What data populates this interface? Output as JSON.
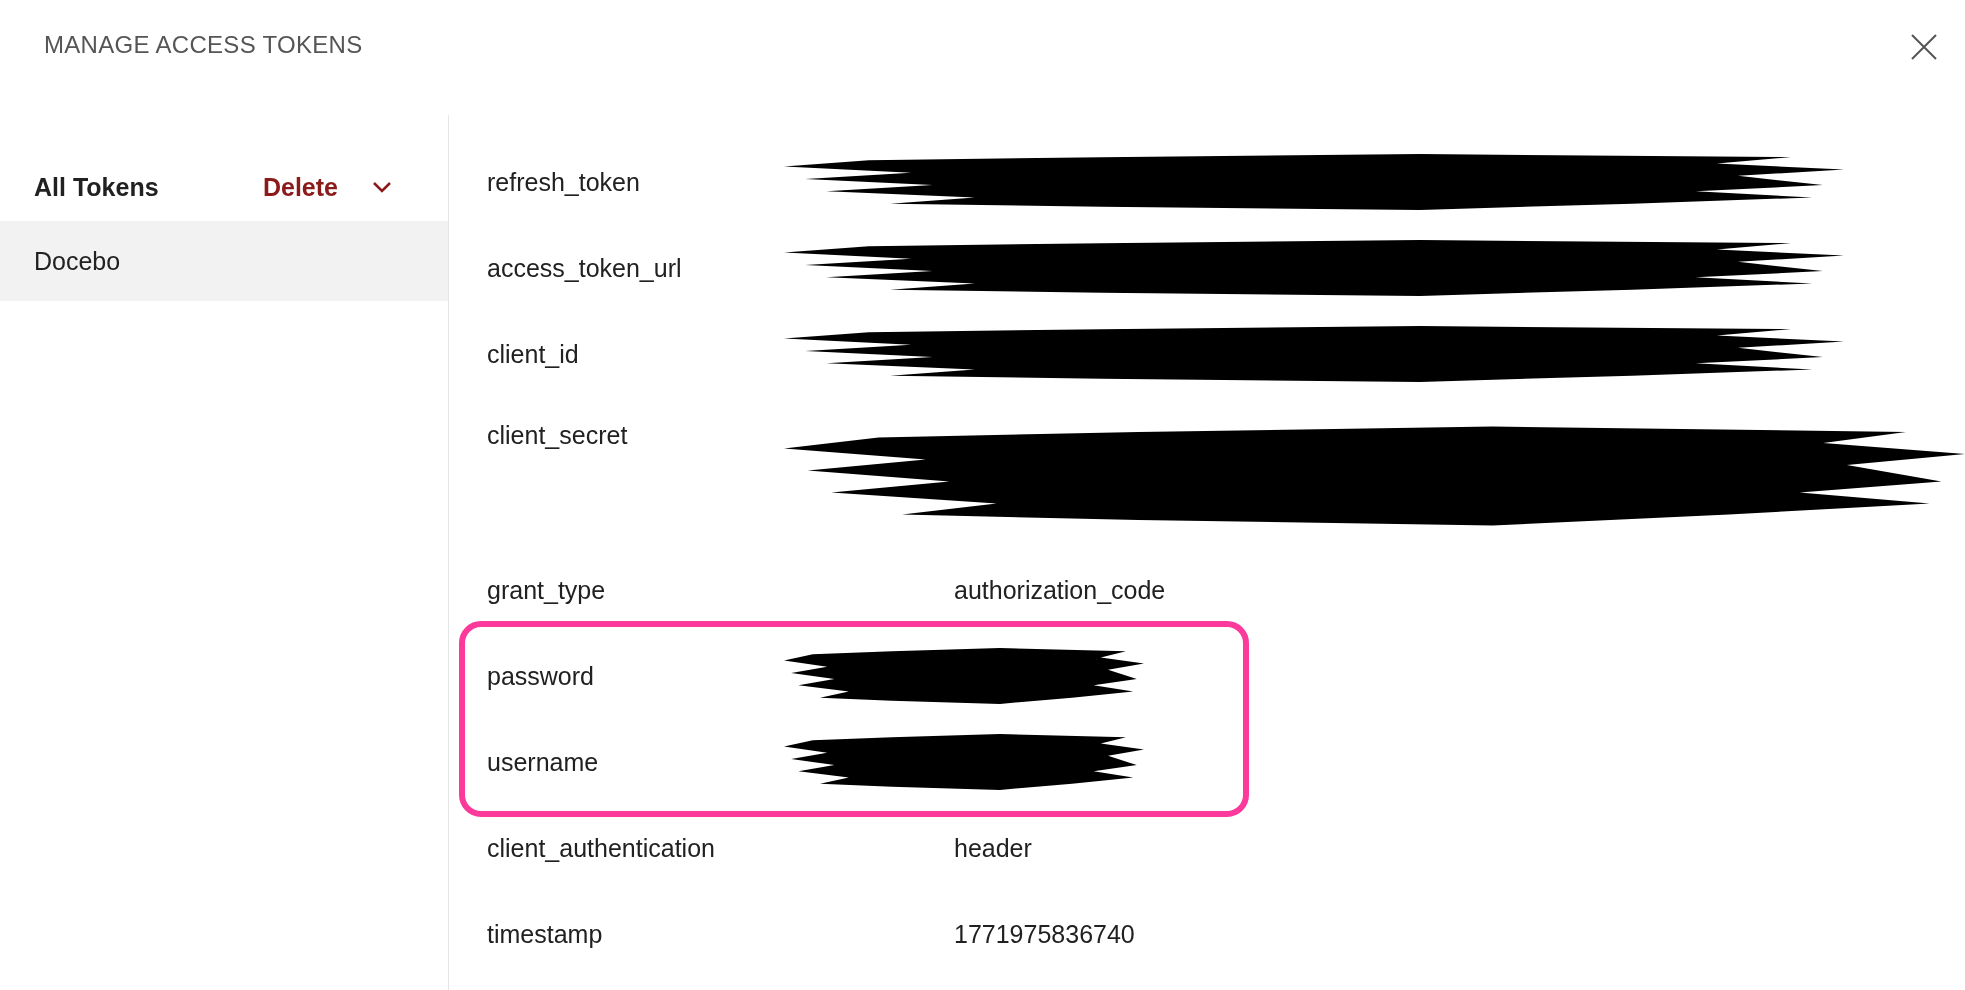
{
  "dialog": {
    "title": "MANAGE ACCESS TOKENS"
  },
  "sidebar": {
    "header": "All Tokens",
    "delete_label": "Delete",
    "items": [
      {
        "label": "Docebo",
        "selected": true
      }
    ]
  },
  "fields": [
    {
      "name": "refresh_token",
      "redacted": true,
      "highlighted": false
    },
    {
      "name": "access_token_url",
      "redacted": true,
      "highlighted": false
    },
    {
      "name": "client_id",
      "redacted": true,
      "highlighted": false
    },
    {
      "name": "client_secret",
      "redacted": true,
      "highlighted": false,
      "tall": true
    },
    {
      "name": "grant_type",
      "value": "authorization_code",
      "redacted": false,
      "highlighted": false
    },
    {
      "name": "password",
      "redacted": true,
      "highlighted": true
    },
    {
      "name": "username",
      "redacted": true,
      "highlighted": true
    },
    {
      "name": "client_authentication",
      "value": "header",
      "redacted": false,
      "highlighted": false
    },
    {
      "name": "timestamp",
      "value": "1771975836740",
      "redacted": false,
      "highlighted": false
    }
  ]
}
